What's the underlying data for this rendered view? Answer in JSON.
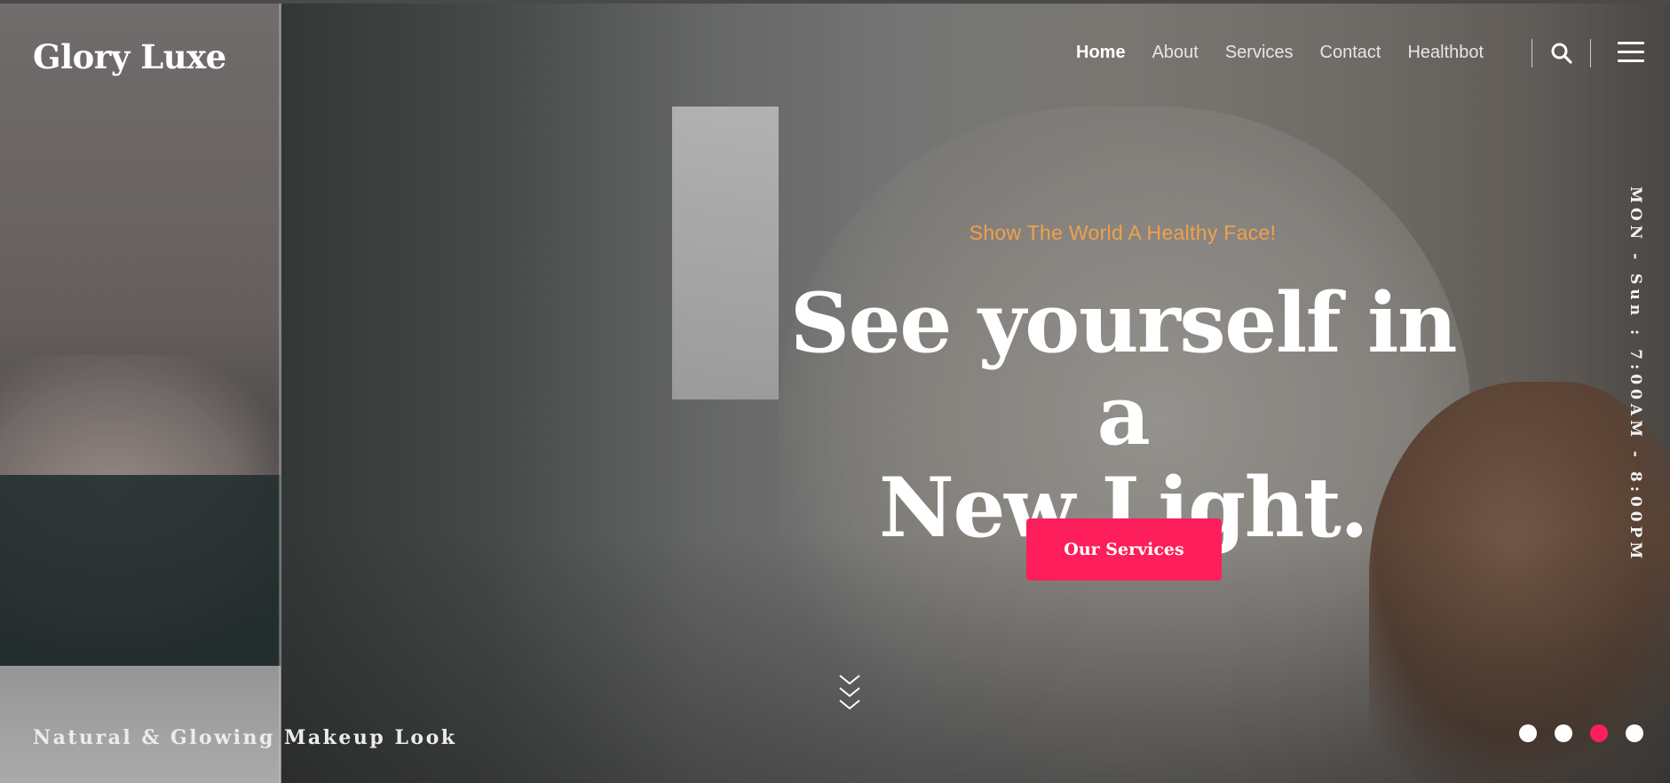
{
  "brand": {
    "name": "Glory Luxe"
  },
  "nav": {
    "items": [
      {
        "label": "Home",
        "active": true
      },
      {
        "label": "About",
        "active": false
      },
      {
        "label": "Services",
        "active": false
      },
      {
        "label": "Contact",
        "active": false
      },
      {
        "label": "Healthbot",
        "active": false
      }
    ],
    "search_icon": "search-icon",
    "menu_icon": "hamburger-menu-icon"
  },
  "hero": {
    "tagline": "Show The World A Healthy Face!",
    "headline_line1": "See yourself in a",
    "headline_line2": "New Light.",
    "cta_label": "Our Services",
    "scroll_icon": "chevrons-down-icon",
    "caption": "Natural & Glowing Makeup Look",
    "hours": "MON - Sun : 7:00AM - 8:00PM"
  },
  "slider": {
    "slide_count": 4,
    "active_index": 2
  },
  "colors": {
    "accent": "#fd1e5b",
    "tagline": "#f0a14b",
    "text": "#ffffff"
  }
}
